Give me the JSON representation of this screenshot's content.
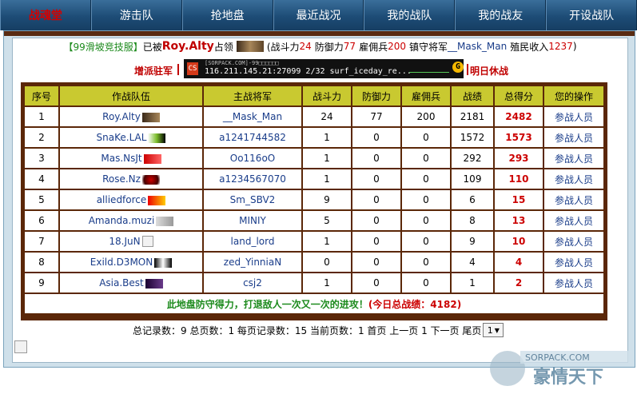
{
  "nav": [
    {
      "label": "战魂堂",
      "active": true
    },
    {
      "label": "游击队",
      "active": false
    },
    {
      "label": "抢地盘",
      "active": false
    },
    {
      "label": "最近战况",
      "active": false
    },
    {
      "label": "我的战队",
      "active": false
    },
    {
      "label": "我的战友",
      "active": false
    },
    {
      "label": "开设战队",
      "active": false
    }
  ],
  "info": {
    "server": "【99滑坡竞技服】",
    "occupied_by": "已被",
    "owner": "Roy.Alty",
    "occupy": "占领",
    "power_label": "(战斗力",
    "power_value": "24",
    "defense_label": "防御力",
    "defense_value": "77",
    "merc_label": "雇佣兵",
    "merc_value": "200",
    "general_label": "镇守将军",
    "general_value": "__Mask_Man",
    "income_label": "殖民收入",
    "income_value": "1237",
    "close": ")"
  },
  "banner": {
    "left_label": "增派驻军",
    "right_label": "明日休战",
    "line1": "[SORPACK.COM]-99□□□□□□",
    "line2": "116.211.145.21:27099  2/32   surf_iceday_re...",
    "cs_icon": "cs-icon",
    "g_icon": "G"
  },
  "table": {
    "headers": [
      "序号",
      "作战队伍",
      "主战将军",
      "战斗力",
      "防御力",
      "雇佣兵",
      "战绩",
      "总得分",
      "您的操作"
    ],
    "rows": [
      {
        "no": "1",
        "team": "Roy.Alty",
        "general": "__Mask_Man",
        "power": "24",
        "defense": "77",
        "merc": "200",
        "record": "2181",
        "score": "2482",
        "action": "参战人员"
      },
      {
        "no": "2",
        "team": "SnaKe.LAL",
        "general": "a1241744582",
        "power": "1",
        "defense": "0",
        "merc": "0",
        "record": "1572",
        "score": "1573",
        "action": "参战人员"
      },
      {
        "no": "3",
        "team": "Mas.NsJt",
        "general": "Oo116oO",
        "power": "1",
        "defense": "0",
        "merc": "0",
        "record": "292",
        "score": "293",
        "action": "参战人员"
      },
      {
        "no": "4",
        "team": "Rose.Nz",
        "general": "a1234567070",
        "power": "1",
        "defense": "0",
        "merc": "0",
        "record": "109",
        "score": "110",
        "action": "参战人员"
      },
      {
        "no": "5",
        "team": "alliedforce",
        "general": "Sm_SBV2",
        "power": "9",
        "defense": "0",
        "merc": "0",
        "record": "6",
        "score": "15",
        "action": "参战人员"
      },
      {
        "no": "6",
        "team": "Amanda.muzi",
        "general": "MINIY",
        "power": "5",
        "defense": "0",
        "merc": "0",
        "record": "8",
        "score": "13",
        "action": "参战人员"
      },
      {
        "no": "7",
        "team": "18.JuN",
        "general": "land_lord",
        "power": "1",
        "defense": "0",
        "merc": "0",
        "record": "9",
        "score": "10",
        "action": "参战人员"
      },
      {
        "no": "8",
        "team": "Exild.D3MON",
        "general": "zed_YinniaN",
        "power": "0",
        "defense": "0",
        "merc": "0",
        "record": "4",
        "score": "4",
        "action": "参战人员"
      },
      {
        "no": "9",
        "team": "Asia.Best",
        "general": "csj2",
        "power": "1",
        "defense": "0",
        "merc": "0",
        "record": "1",
        "score": "2",
        "action": "参战人员"
      }
    ],
    "footer_text": "此地盘防守得力，打退敌人一次又一次的进攻！",
    "footer_total": "(今日总战绩：4182)"
  },
  "pager": {
    "text": "总记录数：9 总页数：1 每页记录数：15 当前页数：1 首页 上一页 1 下一页 尾页",
    "page_select": "1"
  },
  "watermark": {
    "logo_text": "SORPACK.COM",
    "chinese": "豪情天下"
  }
}
